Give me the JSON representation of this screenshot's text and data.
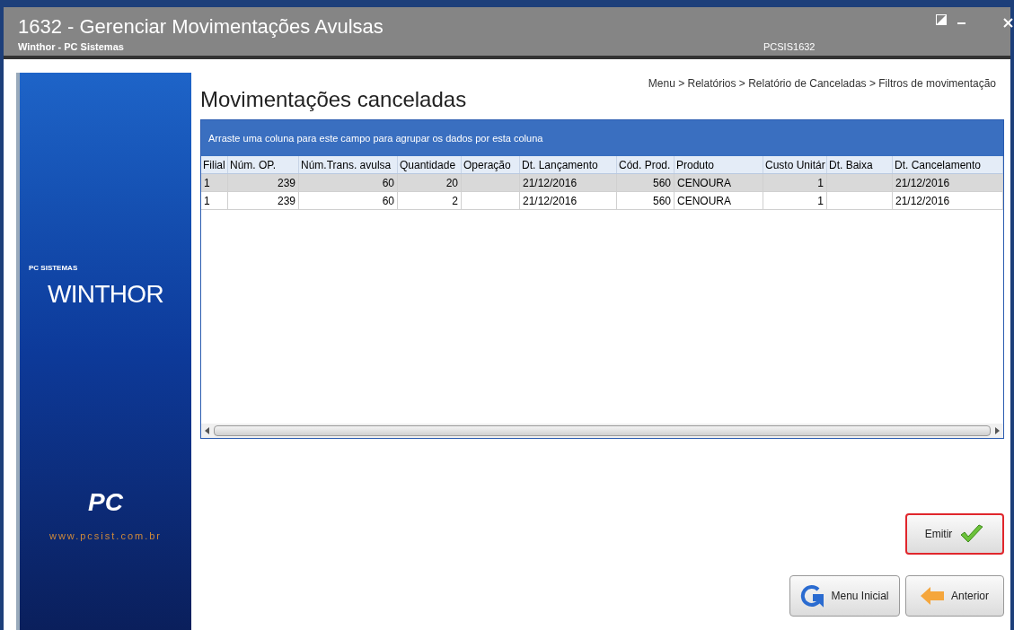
{
  "window": {
    "title": "1632 - Gerenciar Movimentações Avulsas",
    "subtitle": "Winthor - PC Sistemas",
    "code": "PCSIS1632"
  },
  "sidebar": {
    "brand_small": "PC SISTEMAS",
    "brand": "WINTHOR",
    "pc_logo": "PC",
    "url": "www.pcsist.com.br"
  },
  "breadcrumb": "Menu > Relatórios > Relatório de Canceladas > Filtros de movimentação",
  "heading": "Movimentações canceladas",
  "grid": {
    "group_hint": "Arraste uma coluna para este campo para agrupar os dados por esta coluna",
    "columns": [
      "Filial",
      "Núm. OP.",
      "Núm.Trans. avulsa",
      "Quantidade",
      "Operação",
      "Dt. Lançamento",
      "Cód. Prod.",
      "Produto",
      "Custo Unitár",
      "Dt. Baixa",
      "Dt. Cancelamento"
    ],
    "rows": [
      {
        "selected": true,
        "cells": [
          "1",
          "239",
          "60",
          "20",
          "",
          "21/12/2016",
          "560",
          "CENOURA",
          "1",
          "",
          "21/12/2016"
        ]
      },
      {
        "selected": false,
        "cells": [
          "1",
          "239",
          "60",
          "2",
          "",
          "21/12/2016",
          "560",
          "CENOURA",
          "1",
          "",
          "21/12/2016"
        ]
      }
    ]
  },
  "buttons": [
    {
      "kind": "emit",
      "label": "Emitir",
      "focused": true
    },
    {
      "kind": "home",
      "label": "Menu Inicial",
      "focused": false
    },
    {
      "kind": "back",
      "label": "Anterior",
      "focused": false
    }
  ]
}
